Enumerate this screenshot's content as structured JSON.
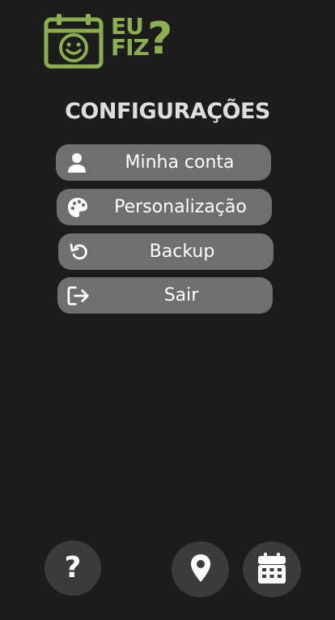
{
  "app": {
    "logo_line1": "EU",
    "logo_line2": "FIZ",
    "logo_mark": "?",
    "brand_color": "#8dae4f"
  },
  "page": {
    "title": "CONFIGURAÇÕES"
  },
  "menu": {
    "items": [
      {
        "label": "Minha conta",
        "icon": "user-icon"
      },
      {
        "label": "Personalização",
        "icon": "palette-icon"
      },
      {
        "label": "Backup",
        "icon": "undo-icon"
      },
      {
        "label": "Sair",
        "icon": "logout-icon"
      }
    ]
  },
  "bottom_nav": {
    "help_glyph": "?",
    "items": [
      {
        "icon": "help-icon"
      },
      {
        "icon": "location-pin-icon"
      },
      {
        "icon": "calendar-icon"
      }
    ]
  }
}
